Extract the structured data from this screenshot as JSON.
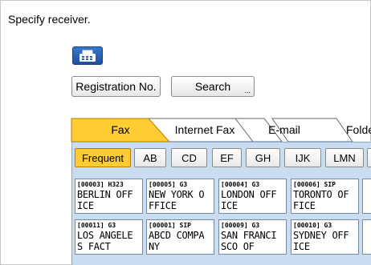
{
  "instruction": "Specify receiver.",
  "buttons": {
    "registration": "Registration No.",
    "search": "Search",
    "search_dots": "..."
  },
  "tabs": [
    "Fax",
    "Internet Fax",
    "E-mail",
    "Folde"
  ],
  "groups": [
    "Frequent",
    "AB",
    "CD",
    "EF",
    "GH",
    "IJK",
    "LMN"
  ],
  "destinations": [
    {
      "code": "[00003] H323",
      "line1": "BERLIN OFF",
      "line2": "ICE"
    },
    {
      "code": "[00005] G3",
      "line1": "NEW YORK O",
      "line2": "FFICE"
    },
    {
      "code": "[00004] G3",
      "line1": "LONDON OFF",
      "line2": "ICE"
    },
    {
      "code": "[00006] SIP",
      "line1": "TORONTO OF",
      "line2": "FICE"
    },
    {
      "code": "[00011] G3",
      "line1": "LOS ANGELE",
      "line2": "S FACT"
    },
    {
      "code": "[00001] SIP",
      "line1": "ABCD COMPA",
      "line2": "NY"
    },
    {
      "code": "[00009] G3",
      "line1": "SAN FRANCI",
      "line2": "SCO OF"
    },
    {
      "code": "[00010] G3",
      "line1": "SYDNEY OFF",
      "line2": "ICE"
    }
  ],
  "colors": {
    "active_tab": "#ffcc33",
    "panel": "#c9dcf0",
    "icon_button": "#2a62b0"
  },
  "icons": {
    "fax_button": "fax-machine-icon"
  }
}
